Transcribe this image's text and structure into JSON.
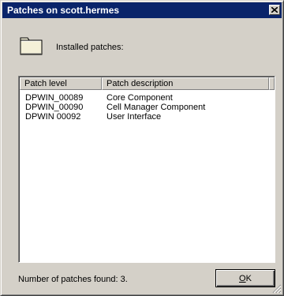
{
  "window": {
    "title": "Patches on scott.hermes"
  },
  "header": {
    "icon": "folder-icon",
    "label": "Installed patches:"
  },
  "table": {
    "columns": [
      "Patch level",
      "Patch description"
    ],
    "rows": [
      [
        "DPWIN_00089",
        "Core Component"
      ],
      [
        "DPWIN_00090",
        "Cell Manager Component"
      ],
      [
        "DPWIN 00092",
        "User Interface"
      ]
    ]
  },
  "footer": {
    "status": "Number of patches found: 3.",
    "ok_accel": "O",
    "ok_rest": "K"
  },
  "colors": {
    "titlebar": "#0a246a",
    "face": "#d4d0c8"
  }
}
